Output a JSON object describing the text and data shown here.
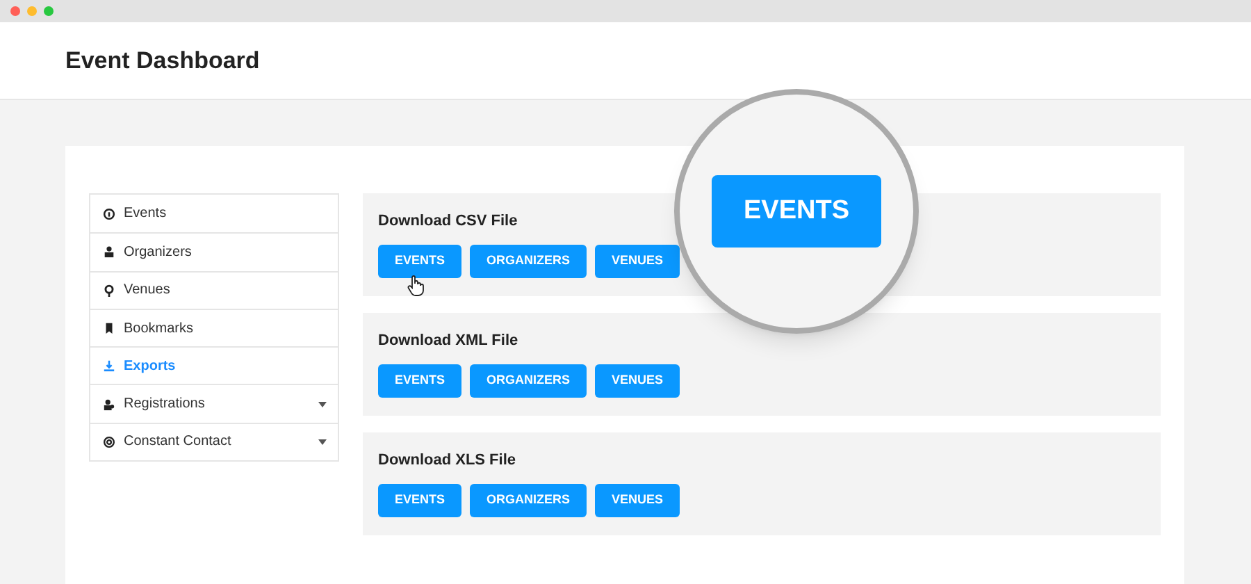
{
  "header": {
    "title": "Event Dashboard"
  },
  "sidebar": {
    "items": [
      {
        "label": "Events",
        "selected": false,
        "expandable": false
      },
      {
        "label": "Organizers",
        "selected": false,
        "expandable": false
      },
      {
        "label": "Venues",
        "selected": false,
        "expandable": false
      },
      {
        "label": "Bookmarks",
        "selected": false,
        "expandable": false
      },
      {
        "label": "Exports",
        "selected": true,
        "expandable": false
      },
      {
        "label": "Registrations",
        "selected": false,
        "expandable": true
      },
      {
        "label": "Constant Contact",
        "selected": false,
        "expandable": true
      }
    ]
  },
  "sections": [
    {
      "title": "Download CSV File",
      "buttons": [
        "EVENTS",
        "ORGANIZERS",
        "VENUES"
      ]
    },
    {
      "title": "Download XML File",
      "buttons": [
        "EVENTS",
        "ORGANIZERS",
        "VENUES"
      ]
    },
    {
      "title": "Download XLS File",
      "buttons": [
        "EVENTS",
        "ORGANIZERS",
        "VENUES"
      ]
    }
  ],
  "magnifier": {
    "label": "EVENTS"
  }
}
